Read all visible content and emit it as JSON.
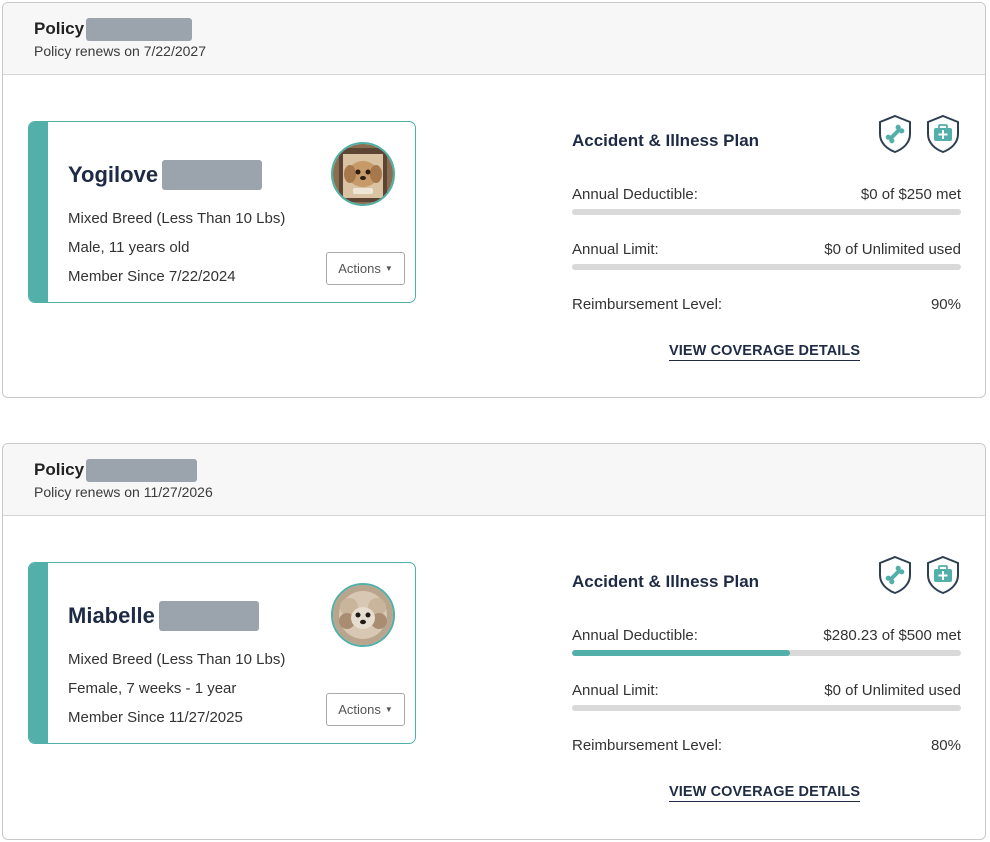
{
  "policies": [
    {
      "label": "Policy",
      "renews": "Policy renews on 7/22/2027",
      "pet": {
        "name": "Yogilove",
        "breed": "Mixed Breed (Less Than 10 Lbs)",
        "sex_age": "Male, 11 years old",
        "member_since": "Member Since 7/22/2024",
        "actions_label": "Actions"
      },
      "plan": {
        "title": "Accident & Illness Plan",
        "deductible_label": "Annual Deductible:",
        "deductible_value": "$0 of $250 met",
        "deductible_progress": 0,
        "limit_label": "Annual Limit:",
        "limit_value": "$0 of Unlimited used",
        "limit_progress": 0,
        "reimbursement_label": "Reimbursement Level:",
        "reimbursement_value": "90%",
        "coverage_link": "VIEW COVERAGE DETAILS"
      }
    },
    {
      "label": "Policy",
      "renews": "Policy renews on 11/27/2026",
      "pet": {
        "name": "Miabelle",
        "breed": "Mixed Breed (Less Than 10 Lbs)",
        "sex_age": "Female, 7 weeks - 1 year",
        "member_since": "Member Since 11/27/2025",
        "actions_label": "Actions"
      },
      "plan": {
        "title": "Accident & Illness Plan",
        "deductible_label": "Annual Deductible:",
        "deductible_value": "$280.23 of $500 met",
        "deductible_progress": 0.5605,
        "limit_label": "Annual Limit:",
        "limit_value": "$0 of Unlimited used",
        "limit_progress": 0,
        "reimbursement_label": "Reimbursement Level:",
        "reimbursement_value": "80%",
        "coverage_link": "VIEW COVERAGE DETAILS"
      }
    }
  ],
  "icons": [
    "bone-shield-icon",
    "medical-kit-shield-icon"
  ],
  "colors": {
    "accent": "#52afa9",
    "navy": "#1f2a44",
    "redaction": "#9ba3ad"
  }
}
